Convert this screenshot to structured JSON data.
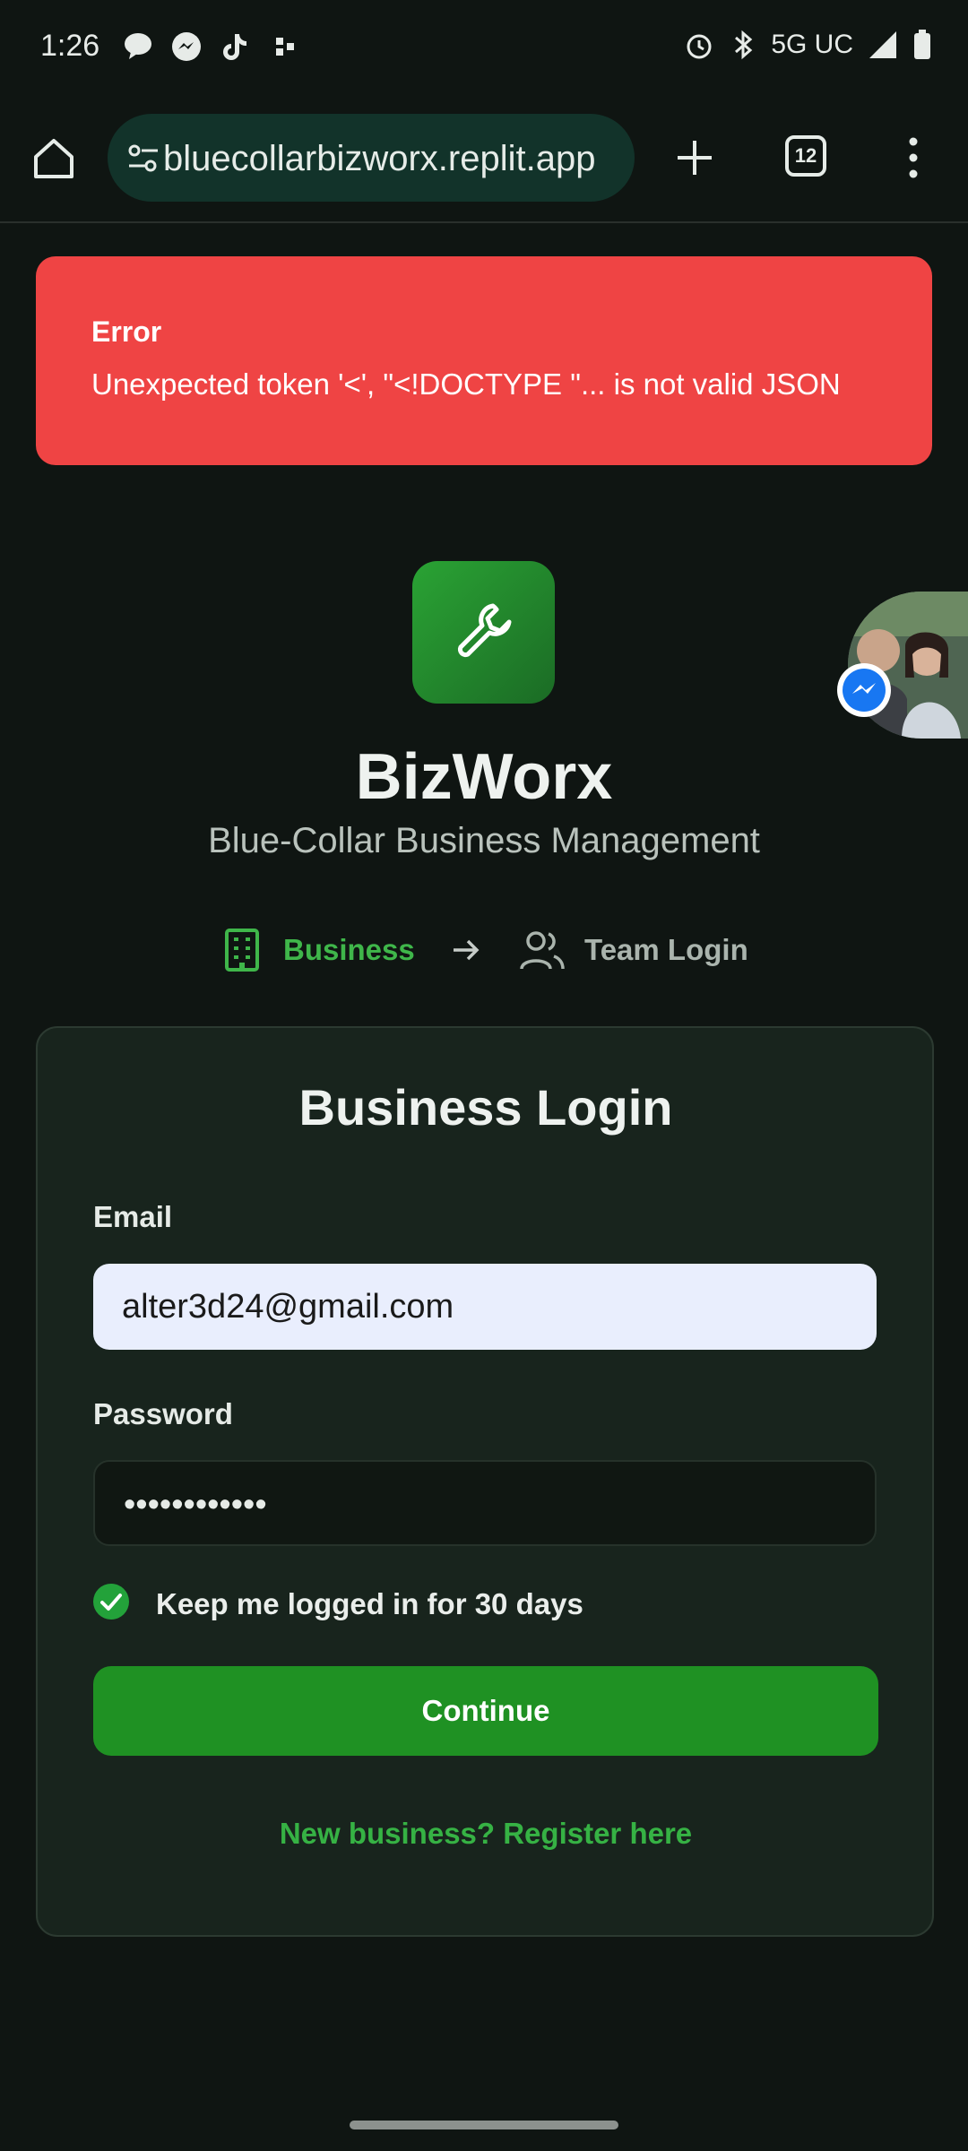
{
  "status_bar": {
    "time": "1:26",
    "network": "5G UC",
    "icons": [
      "chat-bubble-icon",
      "messenger-icon",
      "tiktok-icon",
      "app-icon",
      "alarm-icon",
      "bluetooth-icon",
      "signal-icon",
      "battery-icon"
    ]
  },
  "browser": {
    "url": "bluecollarbizworx.replit.app",
    "tab_count": "12"
  },
  "error": {
    "title": "Error",
    "message": "Unexpected token '<', \"<!DOCTYPE \"... is not valid JSON"
  },
  "brand": {
    "name": "BizWorx",
    "tagline": "Blue-Collar Business Management"
  },
  "steps": {
    "business": "Business",
    "team": "Team Login"
  },
  "login": {
    "title": "Business Login",
    "email_label": "Email",
    "email_value": "alter3d24@gmail.com",
    "password_label": "Password",
    "password_value": "••••••••••••",
    "keep_logged_in": "Keep me logged in for 30 days",
    "keep_logged_in_checked": true,
    "continue": "Continue",
    "register": "New business? Register here"
  },
  "colors": {
    "background": "#0f1512",
    "accent": "#1f9123",
    "error": "#ef4444",
    "link": "#36b244"
  }
}
